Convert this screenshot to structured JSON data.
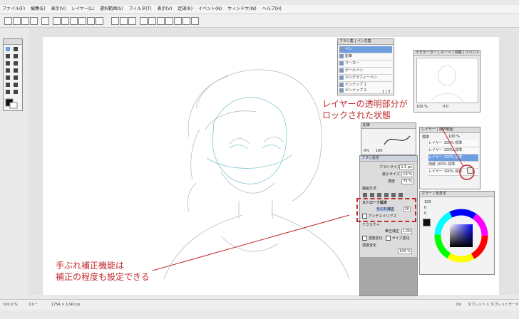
{
  "menu": [
    "ファイル(F)",
    "編集(E)",
    "表示(V)",
    "レイヤー(L)",
    "選択範囲(S)",
    "フィルタ(T)",
    "表示(V)",
    "定規(R)",
    "イベント(N)",
    "ウィンドウ(W)",
    "ヘルプ(H)"
  ],
  "brush_panel": {
    "tabs": "ブラシ集 | ペン先集",
    "items": [
      {
        "label": "ペン",
        "selected": true
      },
      {
        "label": "鉛筆",
        "selected": false
      },
      {
        "label": "マーカー",
        "selected": false
      },
      {
        "label": "ボールペン",
        "selected": false
      },
      {
        "label": "カリグラフィーペン",
        "selected": false
      },
      {
        "label": "ピンナップ 1",
        "selected": false
      },
      {
        "label": "ピンナップ 2",
        "selected": false
      }
    ],
    "footer": "1 / 3"
  },
  "navigator": {
    "tabs": "ナビゲーター | ルーペ | 情報 | イベント",
    "zoom": "100 %",
    "angle": "0.0"
  },
  "brush_preview": {
    "tab": "鉛筆",
    "size_label": "0%",
    "max_label": "100"
  },
  "brush_settings": {
    "header": "ブラシ設定",
    "params": [
      {
        "label": "ブラシサイズ",
        "value": "1.5 px"
      },
      {
        "label": "最小サイズ",
        "value": "10 %"
      },
      {
        "label": "濃度",
        "value": "75 %"
      }
    ],
    "drawing_method": "描画方法",
    "stroke_header": "ストローク設定",
    "stabilizer_label": "手ぶれ補正",
    "stabilizer_value": "20",
    "antialias_label": "アンチエイリアス",
    "texture_label": "テクスチャ",
    "pressure_label": "筆圧補正",
    "pressure_value": "1.00",
    "density_pressure": "濃度変化",
    "size_pressure": "サイズ変化",
    "density_label": "濃度変化",
    "density_value": "100 %"
  },
  "layers": {
    "tabs": "レイヤー | 選択範囲",
    "blend": "標準",
    "opacity": "100 %",
    "rows": [
      {
        "name": "レイヤー",
        "mode": "100% 標準"
      },
      {
        "name": "レイヤー",
        "mode": "100% 標準"
      },
      {
        "name": "レイヤー",
        "mode": "100% 標準"
      },
      {
        "name": "用紙",
        "mode": "100% 標準"
      },
      {
        "name": "レイヤー",
        "mode": "100% 標準"
      }
    ]
  },
  "color_panel": {
    "tabs": "カラー | 色見本",
    "h": "100",
    "s": "0",
    "v": "0"
  },
  "status": {
    "zoom": "100.0 %",
    "angle": "0.0 °",
    "size": "1754 × 1240 px",
    "right1": "On",
    "right2": "タブレット 1",
    "right3": "タブレットモード"
  },
  "annotations": {
    "top_line1": "レイヤーの透明部分が",
    "top_line2": "ロックされた状態",
    "bottom_line1": "手ぶれ補正機能は",
    "bottom_line2": "補正の程度も設定できる"
  },
  "colors": {
    "accent": "#c0282c",
    "selection": "#6d9fe0"
  }
}
